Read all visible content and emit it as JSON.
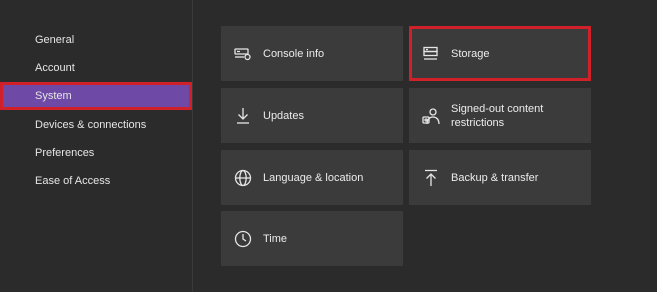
{
  "sidebar": {
    "items": [
      {
        "label": "General"
      },
      {
        "label": "Account"
      },
      {
        "label": "System"
      },
      {
        "label": "Devices & connections"
      },
      {
        "label": "Preferences"
      },
      {
        "label": "Ease of Access"
      }
    ]
  },
  "tiles": {
    "console_info": {
      "label": "Console info",
      "icon": "console-info-icon"
    },
    "storage": {
      "label": "Storage",
      "icon": "storage-icon"
    },
    "updates": {
      "label": "Updates",
      "icon": "download-icon"
    },
    "signed_out": {
      "label": "Signed-out content\nrestrictions",
      "icon": "user-shield-icon"
    },
    "language": {
      "label": "Language & location",
      "icon": "globe-icon"
    },
    "backup": {
      "label": "Backup & transfer",
      "icon": "upload-icon"
    },
    "time": {
      "label": "Time",
      "icon": "clock-icon"
    }
  },
  "colors": {
    "background": "#2b2b2b",
    "tile": "#3b3b3b",
    "selected": "#6e4aa6",
    "highlight_outline": "#d0202a"
  }
}
